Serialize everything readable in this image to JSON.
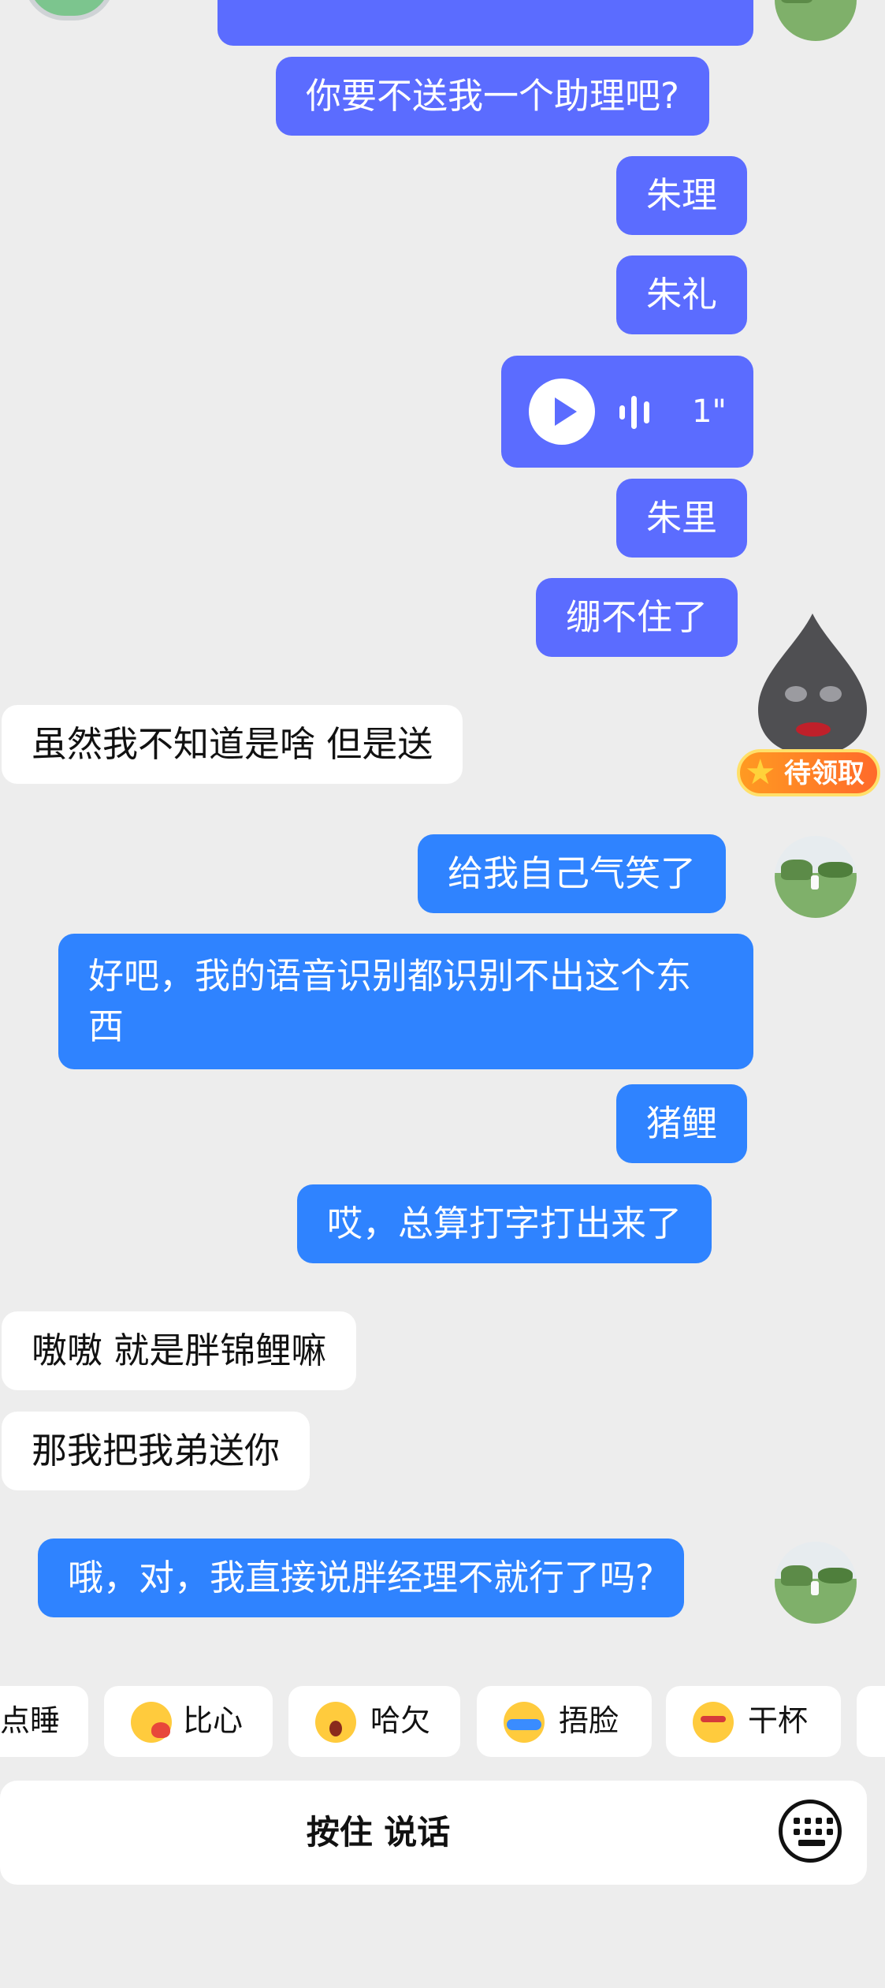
{
  "chat": {
    "messages": [
      {
        "id": "m1",
        "side": "out",
        "color": "purple",
        "text": "你要不送我一个助理吧?"
      },
      {
        "id": "m2",
        "side": "out",
        "color": "purple",
        "text": "朱理"
      },
      {
        "id": "m3",
        "side": "out",
        "color": "purple",
        "text": "朱礼"
      },
      {
        "id": "m4",
        "side": "out",
        "color": "purple",
        "type": "voice",
        "duration": "1\""
      },
      {
        "id": "m5",
        "side": "out",
        "color": "purple",
        "text": "朱里"
      },
      {
        "id": "m6",
        "side": "out",
        "color": "purple",
        "text": "绷不住了"
      },
      {
        "id": "m7",
        "side": "in",
        "text": "虽然我不知道是啥 但是送"
      },
      {
        "id": "m8",
        "side": "out",
        "color": "blue",
        "text": "给我自己气笑了"
      },
      {
        "id": "m9",
        "side": "out",
        "color": "blue",
        "text": "好吧，我的语音识别都识别不出这个东西"
      },
      {
        "id": "m10",
        "side": "out",
        "color": "blue",
        "text": "猪鲤"
      },
      {
        "id": "m11",
        "side": "out",
        "color": "blue",
        "text": "哎，总算打字打出来了"
      },
      {
        "id": "m12",
        "side": "in",
        "text": "嗷嗷 就是胖锦鲤嘛"
      },
      {
        "id": "m13",
        "side": "in",
        "text": "那我把我弟送你"
      },
      {
        "id": "m14",
        "side": "out",
        "color": "blue",
        "text": "哦，对，我直接说胖经理不就行了吗?"
      }
    ],
    "sticker_badge": "待领取"
  },
  "reactions": [
    {
      "label": "点睡"
    },
    {
      "label": "比心",
      "icon": "heart-hands-emoji-icon"
    },
    {
      "label": "哈欠",
      "icon": "yawn-emoji-icon"
    },
    {
      "label": "捂脸",
      "icon": "facepalm-emoji-icon"
    },
    {
      "label": "干杯",
      "icon": "cheers-emoji-icon"
    }
  ],
  "input": {
    "hold_to_talk": "按住 说话"
  },
  "colors": {
    "purple": "#5b6cff",
    "blue": "#2f83ff",
    "bg": "#ededed"
  }
}
